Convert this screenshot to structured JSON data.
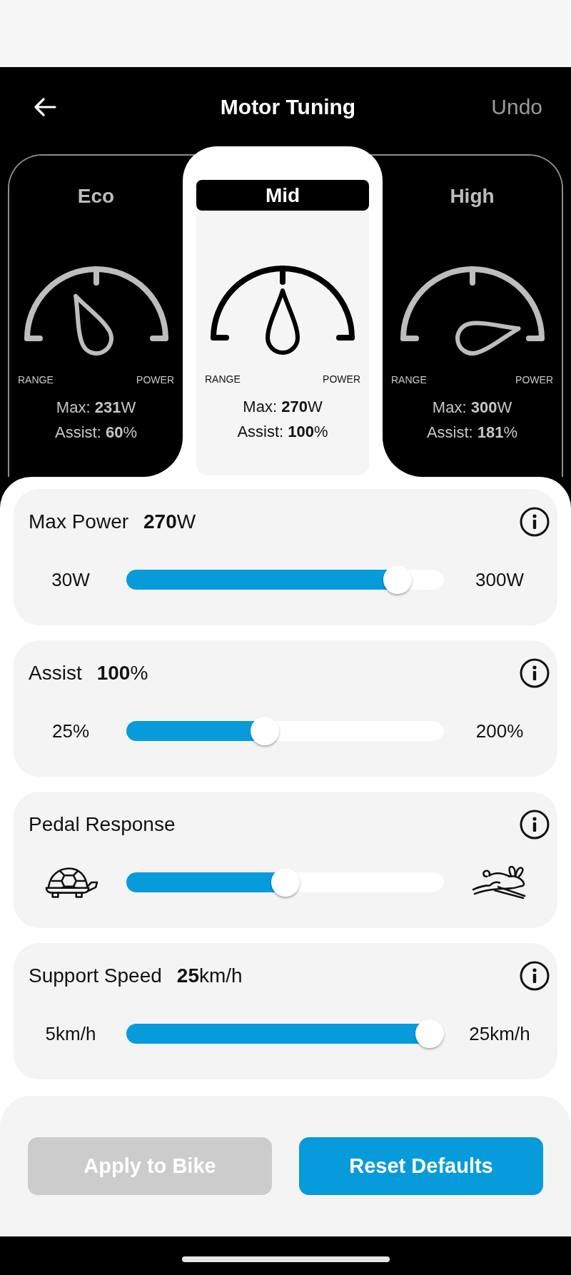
{
  "header": {
    "title": "Motor Tuning",
    "undo": {
      "label": "Undo",
      "disabled": true
    }
  },
  "modes": [
    {
      "name": "Eco",
      "selected": false,
      "kind": "left",
      "range_label": "RANGE",
      "power_label": "POWER",
      "max": "Max: **231**W",
      "assist": "Assist: **60**%"
    },
    {
      "name": "Mid",
      "selected": true,
      "kind": "up",
      "range_label": "RANGE",
      "power_label": "POWER",
      "max": "Max: **270**W",
      "assist": "Assist: **100**%"
    },
    {
      "name": "High",
      "selected": false,
      "kind": "right",
      "range_label": "RANGE",
      "power_label": "POWER",
      "max": "Max: **300**W",
      "assist": "Assist: **181**%"
    }
  ],
  "settings": [
    {
      "kind": "numeric",
      "title": "Max Power",
      "value": "**270**W",
      "min_label": "30W",
      "max_label": "300W",
      "level": 0.89
    },
    {
      "kind": "numeric",
      "title": "Assist",
      "value": "**100**%",
      "min_label": "25%",
      "max_label": "200%",
      "level": 0.43
    },
    {
      "kind": "icons",
      "title": "Pedal Response",
      "level": 0.5
    },
    {
      "kind": "numeric",
      "title": "Support Speed",
      "value": "**25**km/h",
      "min_label": "5km/h",
      "max_label": "25km/h",
      "level": 1.0
    }
  ],
  "actions": [
    {
      "label": "Apply to Bike",
      "disabled": true
    },
    {
      "label": "Reset Defaults",
      "disabled": false
    }
  ]
}
